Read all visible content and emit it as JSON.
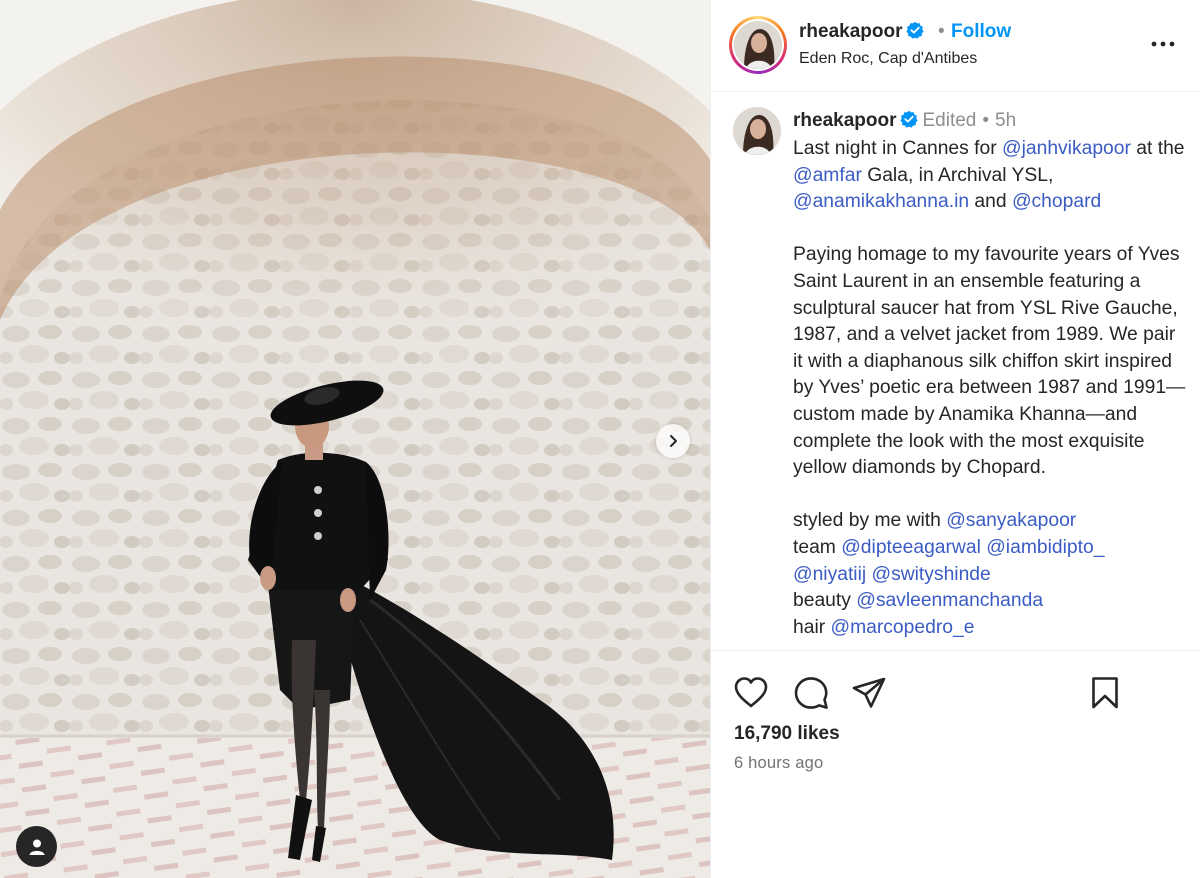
{
  "post": {
    "username": "rheakapoor",
    "follow_label": "Follow",
    "separator": "•",
    "location": "Eden Roc, Cap d'Antibes",
    "photo_alt": "Woman in black YSL hat, velvet jacket and chiffon skirt under a stone arch"
  },
  "caption": {
    "username": "rheakapoor",
    "edited": "Edited",
    "separator": "•",
    "time": "5h",
    "p1": {
      "t1": "Last night in Cannes for ",
      "m1": "@janhvikapoor",
      "t2": " at the ",
      "m2": "@amfar",
      "t3": " Gala, in Archival YSL, ",
      "m3": "@anamikakhanna.in",
      "t4": " and ",
      "m4": "@chopard"
    },
    "p2": "Paying homage to my favourite years of Yves Saint Laurent in an ensemble featuring a sculptural saucer hat from YSL Rive Gauche, 1987, and a velvet jacket from 1989. We pair it with a diaphanous silk chiffon skirt inspired by Yves’ poetic era between 1987 and 1991—custom made by Anamika Khanna—and complete the look with the most exquisite yellow diamonds by Chopard.",
    "credits": {
      "styled_label": "styled by me with ",
      "styled_m1": "@sanyakapoor",
      "team_label": "team ",
      "team_m1": "@dipteeagarwal",
      "team_m2": "@iambidipto_",
      "team_m3": "@niyatiij",
      "team_m4": "@swityshinde",
      "beauty_label": "beauty ",
      "beauty_m1": "@savleenmanchanda",
      "hair_label": "hair ",
      "hair_m1": "@marcopedro_e"
    }
  },
  "actions": {
    "like_icon": "heart-icon",
    "comment_icon": "comment-icon",
    "share_icon": "paper-plane-icon",
    "save_icon": "bookmark-icon"
  },
  "likes": "16,790 likes",
  "posted_ago": "6 hours ago",
  "colors": {
    "follow": "#0095f6",
    "mention": "#3b5cc4",
    "verified": "#0095f6",
    "secondary_text": "#8e8e8e"
  }
}
